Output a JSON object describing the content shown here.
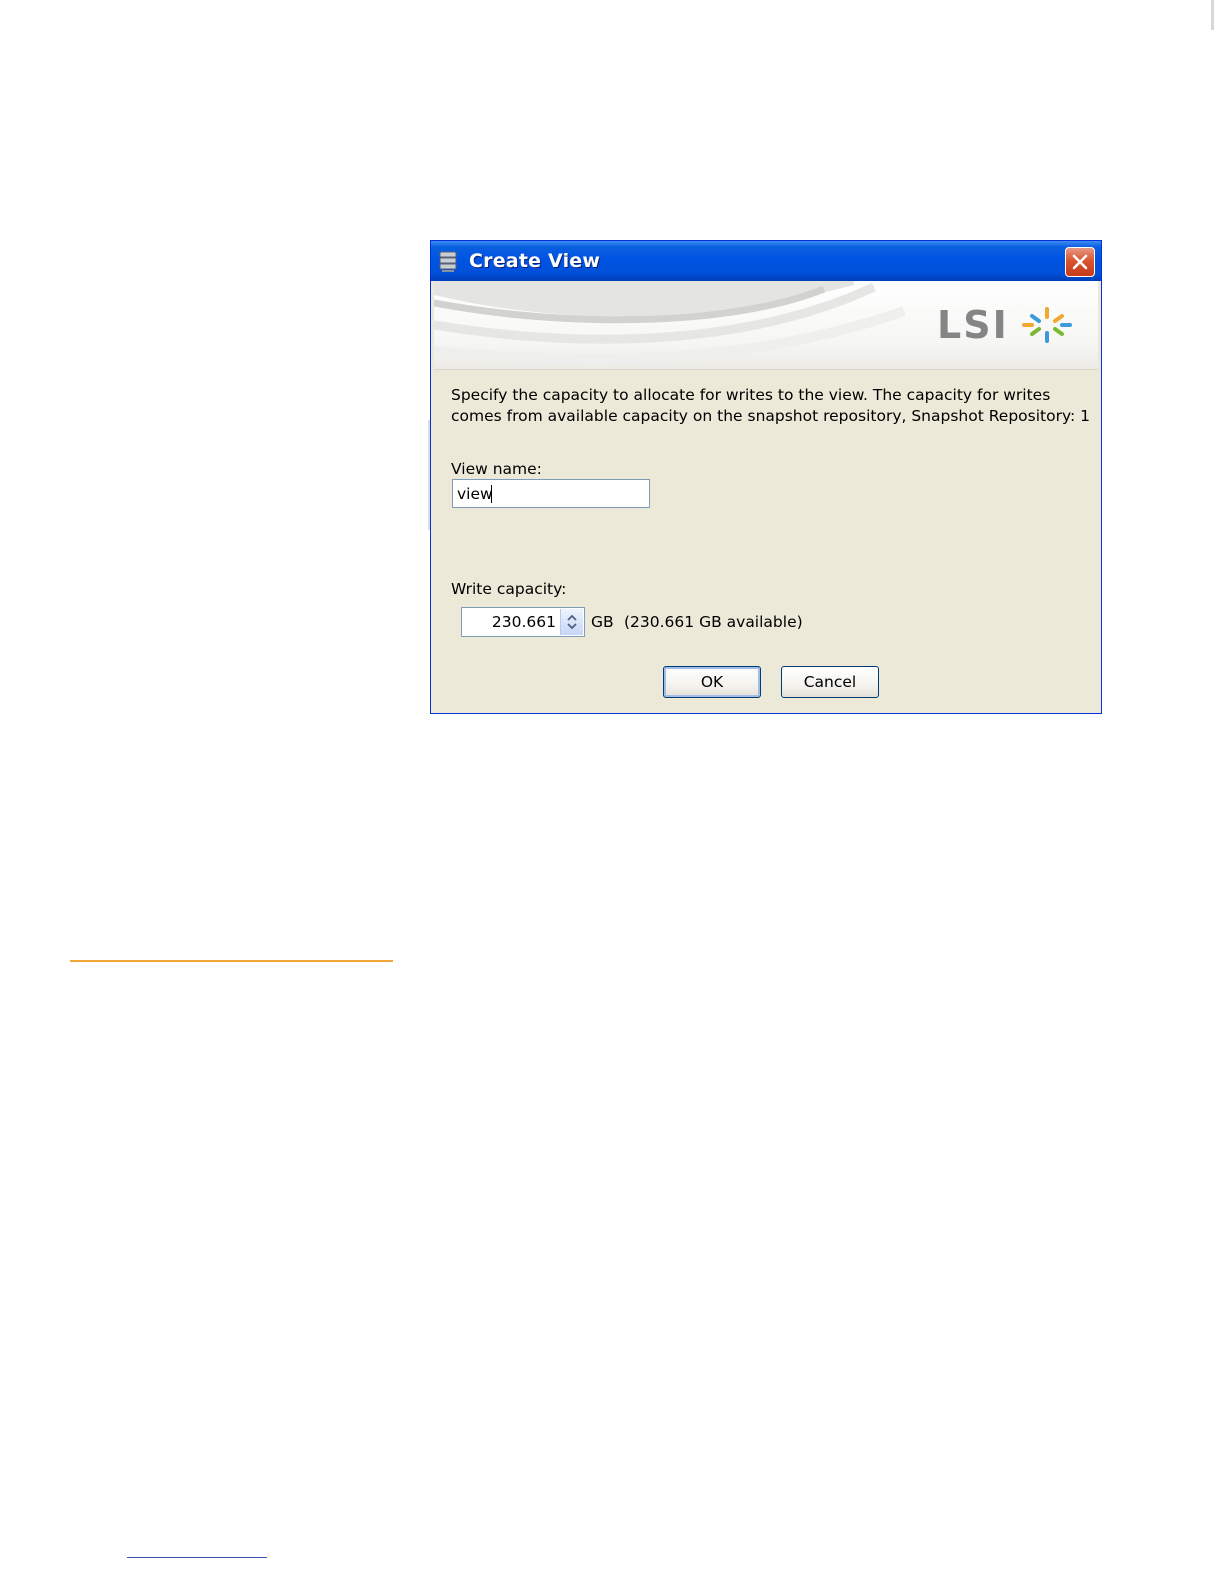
{
  "dialog": {
    "title": "Create View",
    "brand": "LSI",
    "description": "Specify the capacity to allocate for writes to the view. The capacity for writes comes from available capacity on the snapshot repository, Snapshot Repository: 1",
    "view_name_label": "View name:",
    "view_name_value": "view",
    "write_capacity_label": "Write capacity:",
    "write_capacity_value": "230.661",
    "unit": "GB",
    "available": "(230.661 GB available)",
    "ok_label": "OK",
    "cancel_label": "Cancel"
  },
  "icons": {
    "title": "database-icon",
    "close": "close-icon",
    "spinner": "spinner-arrows-icon",
    "brand_mark": "lsi-starburst-logo"
  },
  "colors": {
    "titlebar": "#0054e3",
    "dialog_background": "#ece9d8",
    "close_button": "#d8542f",
    "footnote_rule": "#f2a53a"
  }
}
